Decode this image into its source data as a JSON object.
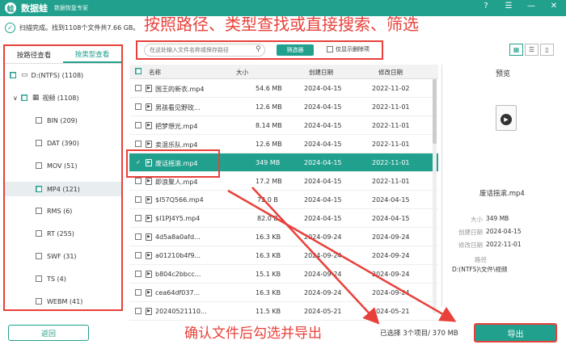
{
  "app": {
    "logo": "蛙",
    "name": "数据蛙",
    "subtitle": "数据恢复专家"
  },
  "window_buttons": [
    "?",
    "☰",
    "—",
    "✕"
  ],
  "status": {
    "check": "✓",
    "text": "扫描完成。找到1108个文件共7.66 GB。"
  },
  "overlay_top": "按照路径、类型查找或直接搜索、筛选",
  "search": {
    "placeholder": "在这处输入文件名称或保存路径",
    "icon": "⚲"
  },
  "filter_label": "筛选器",
  "deleted_only_label": "仅显示删除项",
  "view_icons": [
    "▦",
    "☰",
    "▯"
  ],
  "tabs": [
    "按路径查看",
    "按类型查看"
  ],
  "tree": [
    {
      "label": "D:(NTFS) (1108)"
    },
    {
      "label": "视频 (1108)"
    },
    {
      "label": "BIN (209)"
    },
    {
      "label": "DAT (390)"
    },
    {
      "label": "MOV (51)"
    },
    {
      "label": "MP4 (121)"
    },
    {
      "label": "RMS (6)"
    },
    {
      "label": "RT (255)"
    },
    {
      "label": "SWF (31)"
    },
    {
      "label": "TS (4)"
    },
    {
      "label": "WEBM (41)"
    }
  ],
  "columns": [
    "名称",
    "大小",
    "创建日期",
    "修改日期"
  ],
  "rows": [
    {
      "name": "国王的新衣.mp4",
      "size": "54.6 MB",
      "created": "2024-04-15",
      "modified": "2022-11-02"
    },
    {
      "name": "男孩看见野玫...",
      "size": "12.6 MB",
      "created": "2024-04-15",
      "modified": "2022-11-01"
    },
    {
      "name": "把梦想光.mp4",
      "size": "8.14 MB",
      "created": "2024-04-15",
      "modified": "2022-11-01"
    },
    {
      "name": "卖混乐队.mp4",
      "size": "12.6 MB",
      "created": "2024-04-15",
      "modified": "2022-11-01"
    },
    {
      "name": "废话摇滚.mp4",
      "size": "349 MB",
      "created": "2024-04-15",
      "modified": "2022-11-01"
    },
    {
      "name": "即浪聚人.mp4",
      "size": "17.2 MB",
      "created": "2024-04-15",
      "modified": "2022-11-01"
    },
    {
      "name": "$I57Q566.mp4",
      "size": "72.0 B",
      "created": "2024-04-15",
      "modified": "2024-04-15"
    },
    {
      "name": "$I1PJ4Y5.mp4",
      "size": "82.0 B",
      "created": "2024-04-15",
      "modified": "2024-04-15"
    },
    {
      "name": "4d5a8a0afd...",
      "size": "16.3 KB",
      "created": "2024-09-24",
      "modified": "2024-09-24"
    },
    {
      "name": "a01210b4f9...",
      "size": "16.3 KB",
      "created": "2024-09-24",
      "modified": "2024-09-24"
    },
    {
      "name": "b804c2bbcc...",
      "size": "15.1 KB",
      "created": "2024-09-24",
      "modified": "2024-09-24"
    },
    {
      "name": "cea64df037...",
      "size": "16.3 KB",
      "created": "2024-09-24",
      "modified": "2024-09-24"
    },
    {
      "name": "20240521110...",
      "size": "11.5 KB",
      "created": "2024-05-21",
      "modified": "2024-05-21"
    }
  ],
  "file_badge": "▶",
  "preview": {
    "title": "预览",
    "play": "▶",
    "name": "废话摇滚.mp4",
    "props": [
      {
        "label": "大小",
        "value": "349 MB"
      },
      {
        "label": "创建日期",
        "value": "2024-04-15"
      },
      {
        "label": "修改日期",
        "value": "2022-11-01"
      }
    ],
    "path_label": "路径",
    "path": "D:(NTFS)\\文件\\视频"
  },
  "back_label": "返回",
  "overlay_bottom": "确认文件后勾选并导出",
  "selected_info": "已选择 3个项目/ 370 MB",
  "export_label": "导出",
  "accent": "#22a08e",
  "annotation_color": "#e8403a"
}
